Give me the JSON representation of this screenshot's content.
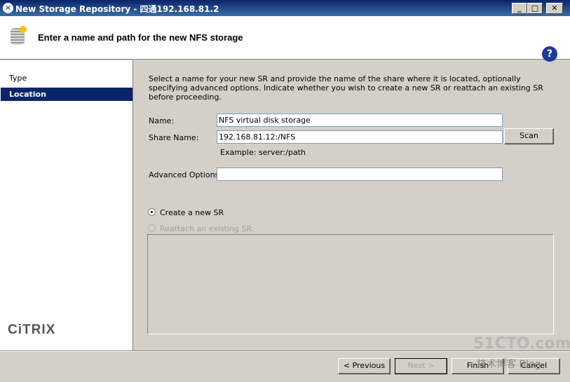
{
  "window": {
    "title": "New Storage Repository - 四通192.168.81.2",
    "minimize": "_",
    "maximize": "□",
    "close": "✕"
  },
  "header": {
    "title": "Enter a name and path for the new NFS storage",
    "help": "?"
  },
  "sidebar": {
    "items": [
      {
        "label": "Type",
        "selected": false
      },
      {
        "label": "Location",
        "selected": true
      }
    ],
    "logo": "CiTRIX"
  },
  "main": {
    "intro": "Select a name for your new SR and provide the name of the share where it is located, optionally specifying advanced options. Indicate whether you wish to create a new SR or reattach an existing SR before proceeding.",
    "name_label": "Name:",
    "name_value": "NFS virtual disk storage",
    "share_label": "Share Name:",
    "share_value": "192.168.81.12:/NFS",
    "scan_label": "Scan",
    "example": "Example: server:/path",
    "advanced_label": "Advanced Options:",
    "advanced_value": "",
    "radio_create": "Create a new SR",
    "radio_create_checked": true,
    "radio_reattach": "Reattach an existing SR:",
    "radio_reattach_enabled": false
  },
  "footer": {
    "previous": "< Previous",
    "next": "Next >",
    "finish": "Finish",
    "cancel": "Cancel"
  },
  "watermark": {
    "line1": "51CTO.com",
    "line2": "技术博客 Blog"
  }
}
